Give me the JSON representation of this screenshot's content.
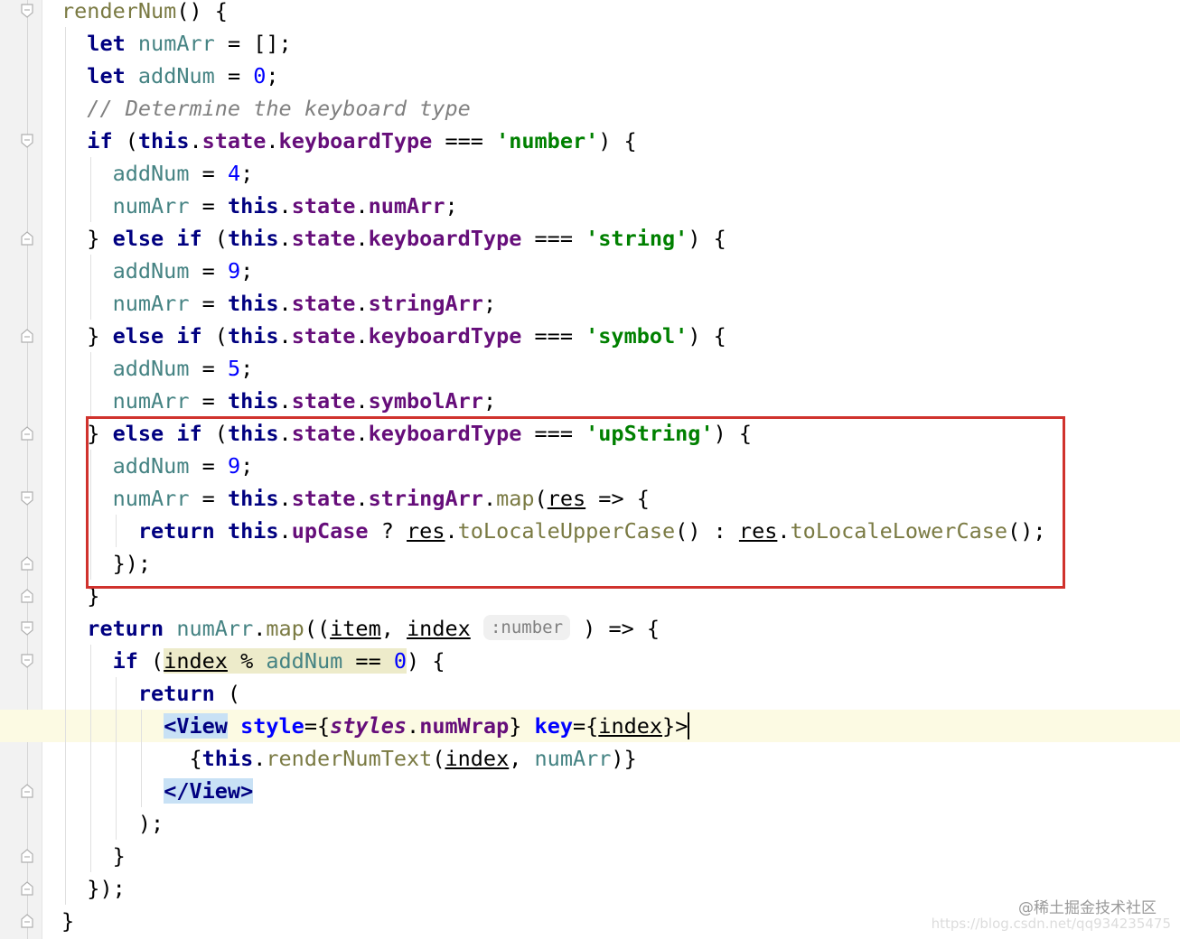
{
  "icons": {
    "fold_open": "fold-open-icon",
    "fold_close": "fold-close-icon"
  },
  "colors": {
    "keyword": "#000080",
    "property": "#660e7a",
    "variable": "#458383",
    "string": "#008000",
    "number": "#0000ff",
    "comment": "#808080",
    "highlight_box": "#d0322d",
    "current_line": "#fcfae3"
  },
  "code": {
    "l1": {
      "name": "renderNum",
      "rest": "() {"
    },
    "l2": {
      "kw": "let",
      "var": "numArr",
      "rest": " = [];"
    },
    "l3": {
      "kw": "let",
      "var": "addNum",
      "eq": " = ",
      "num": "0",
      "end": ";"
    },
    "l4": {
      "comment": "// Determine the keyboard type"
    },
    "l5": {
      "kw": "if",
      "open": " (",
      "this": "this",
      "state": "state",
      "prop": "keyboardType",
      "op": " === ",
      "str": "'number'",
      "end": ") {"
    },
    "l6": {
      "var": "addNum",
      "eq": " = ",
      "num": "4",
      "end": ";"
    },
    "l7": {
      "var": "numArr",
      "eq": " = ",
      "this": "this",
      "state": "state",
      "prop": "numArr",
      "end": ";"
    },
    "l8": {
      "pre": "} ",
      "kw1": "else",
      "kw2": "if",
      "open": " (",
      "this": "this",
      "state": "state",
      "prop": "keyboardType",
      "op": " === ",
      "str": "'string'",
      "end": ") {"
    },
    "l9": {
      "var": "addNum",
      "eq": " = ",
      "num": "9",
      "end": ";"
    },
    "l10": {
      "var": "numArr",
      "eq": " = ",
      "this": "this",
      "state": "state",
      "prop": "stringArr",
      "end": ";"
    },
    "l11": {
      "pre": "} ",
      "kw1": "else",
      "kw2": "if",
      "open": " (",
      "this": "this",
      "state": "state",
      "prop": "keyboardType",
      "op": " === ",
      "str": "'symbol'",
      "end": ") {"
    },
    "l12": {
      "var": "addNum",
      "eq": " = ",
      "num": "5",
      "end": ";"
    },
    "l13": {
      "var": "numArr",
      "eq": " = ",
      "this": "this",
      "state": "state",
      "prop": "symbolArr",
      "end": ";"
    },
    "l14": {
      "pre": "} ",
      "kw1": "else",
      "kw2": "if",
      "open": " (",
      "this": "this",
      "state": "state",
      "prop": "keyboardType",
      "op": " === ",
      "str": "'upString'",
      "end": ") {"
    },
    "l15": {
      "var": "addNum",
      "eq": " = ",
      "num": "9",
      "end": ";"
    },
    "l16": {
      "var": "numArr",
      "eq": " = ",
      "this": "this",
      "state": "state",
      "prop": "stringArr",
      "method": "map",
      "open": "(",
      "param": "res",
      "arrow": " => {"
    },
    "l17": {
      "kw": "return",
      "this": "this",
      "prop": "upCase",
      "q": " ? ",
      "param1": "res",
      "fn1": "toLocaleUpperCase",
      "colon": "() : ",
      "param2": "res",
      "fn2": "toLocaleLowerCase",
      "end": "();"
    },
    "l18": {
      "text": "});"
    },
    "l19": {
      "text": "}"
    },
    "l20": {
      "kw": "return",
      "var": "numArr",
      "method": "map",
      "open": "((",
      "param1": "item",
      "comma": ", ",
      "param2": "index",
      "hint": ":number",
      "arrow": ") => {"
    },
    "l21": {
      "kw": "if",
      "open": " (",
      "param": "index",
      "op": " % ",
      "var": "addNum",
      "eq": " == ",
      "num": "0",
      "close": ")",
      "end": " {"
    },
    "l22": {
      "kw": "return",
      "end": " ("
    },
    "l23": {
      "tag": "<View",
      "attr1": "style",
      "eq1": "={",
      "styles": "styles",
      "prop": "numWrap",
      "close1": "}",
      "attr2": "key",
      "eq2": "={",
      "param": "index",
      "close2": "}>"
    },
    "l24": {
      "open": "{",
      "this": "this",
      "fn": "renderNumText",
      "paren": "(",
      "param": "index",
      "comma": ", ",
      "var": "numArr",
      "close": ")}"
    },
    "l25": {
      "tag": "</View>"
    },
    "l26": {
      "text": ");"
    },
    "l27": {
      "text": "}"
    },
    "l28": {
      "text": "});"
    },
    "l29": {
      "text": "}"
    }
  },
  "watermark": {
    "text": "@稀土掘金技术社区",
    "url": "https://blog.csdn.net/qq934235475"
  }
}
